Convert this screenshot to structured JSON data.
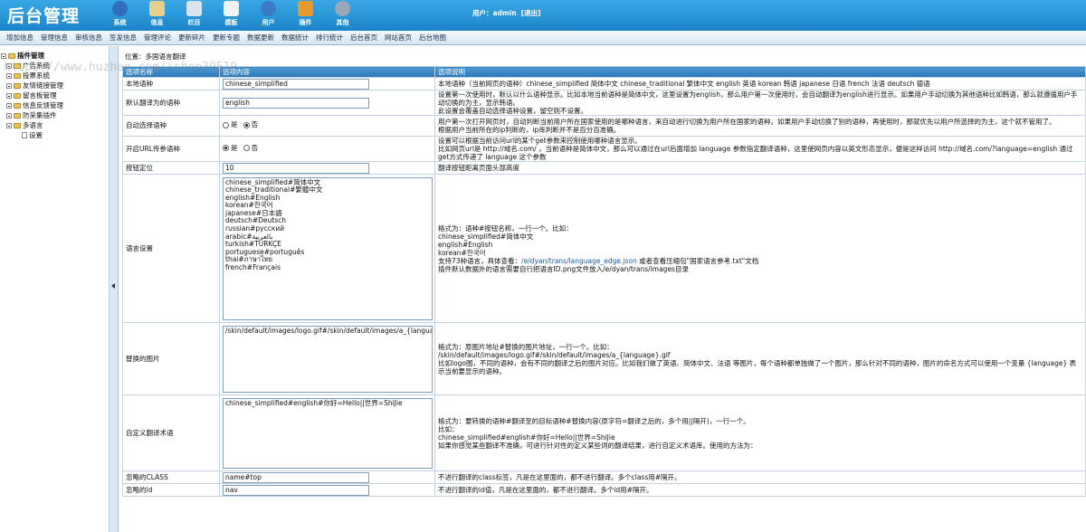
{
  "brand": "后台管理",
  "top_nav": [
    {
      "label": "系统",
      "icon": "globe-icon",
      "color": "#2f6fb8"
    },
    {
      "label": "信息",
      "icon": "pencil-paper-icon",
      "color": "#e8d08a"
    },
    {
      "label": "栏目",
      "icon": "folder-icon",
      "color": "#d8e4f0"
    },
    {
      "label": "模板",
      "icon": "monitor-icon",
      "color": "#f2f2f2"
    },
    {
      "label": "用户",
      "icon": "user-icon",
      "color": "#3c7ac4"
    },
    {
      "label": "插件",
      "icon": "tools-icon",
      "color": "#e89a2a"
    },
    {
      "label": "其他",
      "icon": "gear-icon",
      "color": "#9aa8b8"
    }
  ],
  "user": {
    "label": "用户：admin",
    "logout": "[退出]"
  },
  "sub_nav": [
    "增加信息",
    "管理信息",
    "审核信息",
    "签发信息",
    "管理评论",
    "更新碎片",
    "更新专题",
    "数据更新",
    "数据统计",
    "排行统计",
    "后台首页",
    "网站首页",
    "后台地图"
  ],
  "sidebar": {
    "root": "插件管理",
    "items": [
      "广告系统",
      "投票系统",
      "友情链接管理",
      "留言板管理",
      "信息反馈管理",
      "防采集插件",
      "多语言"
    ],
    "child": "设置"
  },
  "position": "位置：多国语言翻译",
  "watermark": "https://www.huzhan.com/ishop39519",
  "table": {
    "headers": [
      "选项名称",
      "选项内容",
      "选项说明"
    ],
    "rows": [
      {
        "label": "本地语种",
        "type": "input",
        "value": "chinese_simplified",
        "desc": [
          "本地语种（当前网页的语种）chinese_simplified 简体中文 chinese_traditional 繁体中文 english 英语 korean 韩语 japanese 日语 french 法语 deutsch 德语"
        ]
      },
      {
        "label": "默认翻译为的语种",
        "type": "input",
        "value": "english",
        "desc": [
          "设置第一次使用时，默认以什么语种显示。比如本地当前语种是简体中文，这里设置为english，那么用户第一次使用时，会自动翻译为english进行显示。如果用户手动切换为其他语种比如韩语，那么就遵循用户手动切换的为主，显示韩语。",
          "此设置会覆盖自动选择语种设置，留空则不设置。"
        ]
      },
      {
        "label": "自动选择语种",
        "type": "radio",
        "options": [
          "是",
          "否"
        ],
        "selected": "否",
        "desc": [
          "用户第一次打开网页时，自动判断当前用户所在国家使用的是哪种语言，来自动进行切换为用户所在国家的语种。如果用户手动切换了别的语种，再使用时，那就优先以用户所选择的为主，这个就不管用了。",
          "根据用户当前所在的ip判断的，ip库判断并不是百分百准确。"
        ]
      },
      {
        "label": "开启URL传参语种",
        "type": "radio",
        "options": [
          "是",
          "否"
        ],
        "selected": "是",
        "desc": [
          "设置可以根据当前访问url的某个get参数来控制使用哪种语言显示。",
          "比如网页url是 http://域名.com/ ，当前语种是简体中文，那么可以通过在url后面增加 language 参数指定翻译语种，这里使网页内容以英文形态显示，便是这样访问 http://域名.com/?language=english 通过get方式传递了 language 这个参数"
        ]
      },
      {
        "label": "按钮定位",
        "type": "input",
        "value": "10",
        "desc": [
          "翻译按钮距离页面头部高度"
        ]
      },
      {
        "label": "语言设置",
        "type": "textarea",
        "value": "chinese_simplified#简体中文\nchinese_traditional#繁體中文\nenglish#English\nkorean#한국어\njapanese#日本語\ndeutsch#Deutsch\nrussian#русский\narabic#بالعربية\nturkish#TÜRKÇE\nportuguese#português\nthai#ภาษาไทย\nfrench#Français",
        "desc": [
          "格式为：语种#按钮名称，一行一个。比如：",
          "chinese_simplified#简体中文",
          "english#English",
          "korean#한국어"
        ],
        "link_prefix": "支持73种语言，具体查看：",
        "link": "/e/dyan/trans/language_edge.json",
        "link_suffix": " 或者查看压缩包\"国家语言参考.txt\"文档",
        "desc_tail": "插件默认数据外的语言需要自行把语言ID.png文件放入/e/dyan/trans/images目录"
      },
      {
        "label": "替换的图片",
        "type": "textarea",
        "value": "/skin/default/images/logo.gif#/skin/default/images/a_{language}.gif",
        "desc": [
          "格式为：原图片地址#替换的图片地址，一行一个。比如：",
          "/skin/default/images/logo.gif#/skin/default/images/a_{language}.gif",
          "比如logo图，不同的语种，会有不同的翻译之后的图片对应。比如我们做了英语、简体中文、法语 等图片，每个语种都单独做了一个图片，那么针对不同的语种，图片的命名方式可以使用一个变量 {language} 表示当前要显示的语种。"
        ]
      },
      {
        "label": "自定义翻译术语",
        "type": "textarea",
        "value": "chinese_simplified#english#你好=Hello||世界=ShiJie",
        "desc": [
          "格式为：要转换的语种#翻译至的目标语种#替换内容(原字符=翻译之后的，多个用||隔开)，一行一个。",
          "比如：",
          "chinese_simplified#english#你好=Hello||世界=ShiJie",
          "如果你感觉某些翻译不准确，可进行针对性的定义某些词的翻译结果，进行自定义术语库。使用的方法为："
        ]
      },
      {
        "label": "忽略的CLASS",
        "type": "input",
        "value": "name#top",
        "desc": [
          "不进行翻译的class标签，凡是在这里面的，都不进行翻译。多个class用#隔开。"
        ]
      },
      {
        "label": "忽略的id",
        "type": "input",
        "value": "nav",
        "desc": [
          "不进行翻译的id值，凡是在这里面的，都不进行翻译。多个id用#隔开。"
        ]
      }
    ]
  }
}
